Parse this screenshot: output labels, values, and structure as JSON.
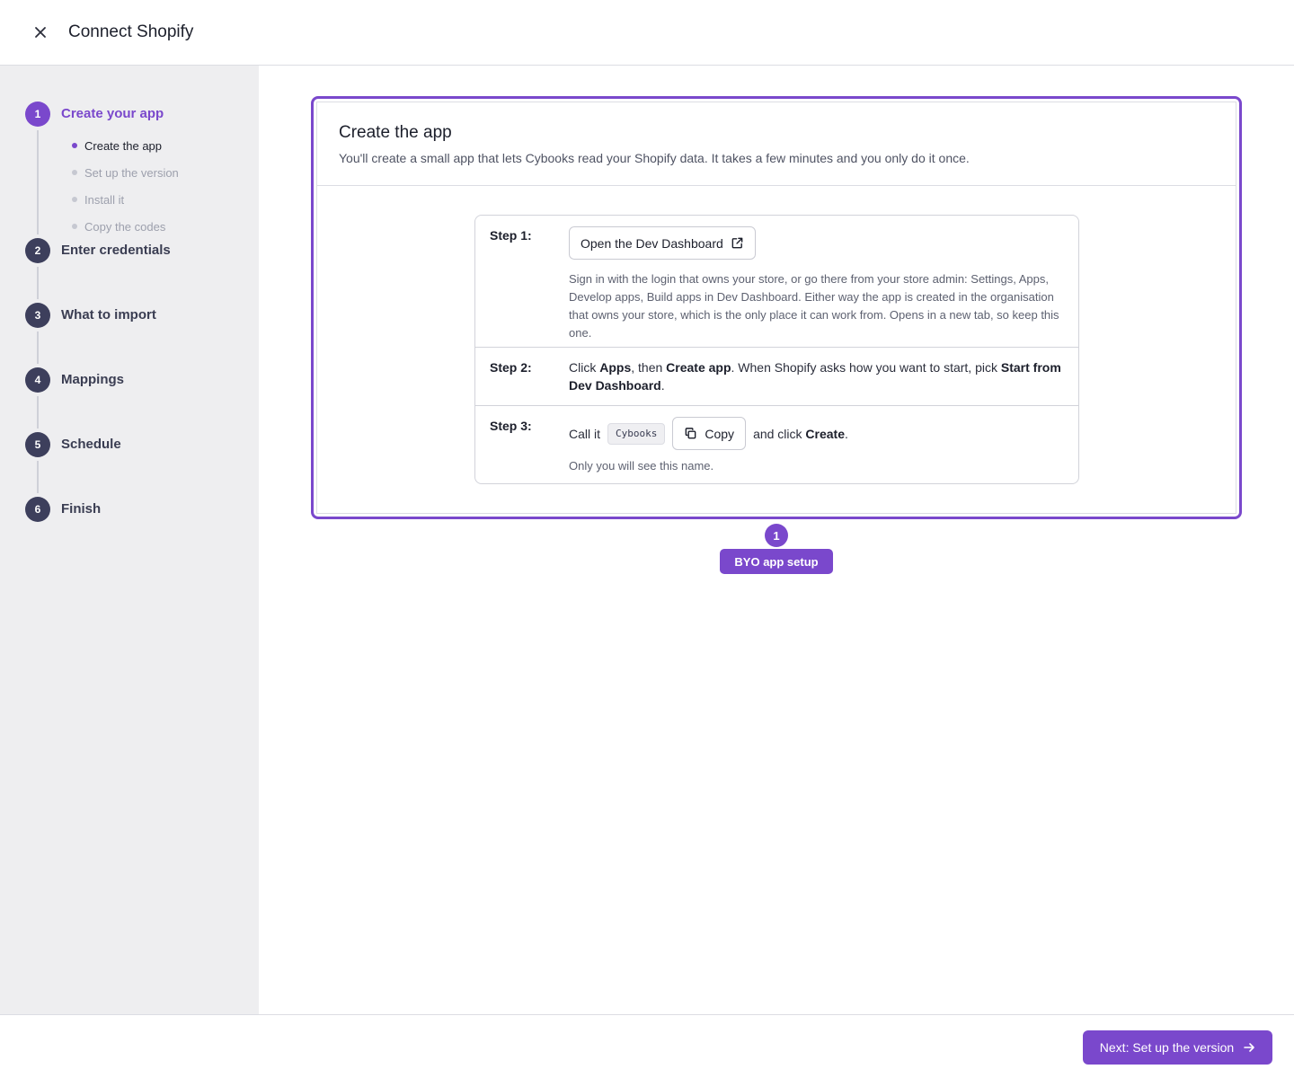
{
  "header": {
    "title": "Connect Shopify",
    "close_icon": "close-icon"
  },
  "sidebar": {
    "steps": [
      {
        "number": "1",
        "label": "Create your app",
        "active": true,
        "substeps": [
          {
            "label": "Create the app",
            "current": true
          },
          {
            "label": "Set up the version",
            "current": false
          },
          {
            "label": "Install it",
            "current": false
          },
          {
            "label": "Copy the codes",
            "current": false
          }
        ]
      },
      {
        "number": "2",
        "label": "Enter credentials"
      },
      {
        "number": "3",
        "label": "What to import"
      },
      {
        "number": "4",
        "label": "Mappings"
      },
      {
        "number": "5",
        "label": "Schedule"
      },
      {
        "number": "6",
        "label": "Finish"
      }
    ]
  },
  "card": {
    "title": "Create the app",
    "subtitle": "You'll create a small app that lets Cybooks read your Shopify data. It takes a few minutes and you only do it once.",
    "steps": [
      {
        "label": "Step 1:",
        "button": "Open the Dev Dashboard",
        "button_icon": "external-link-icon",
        "description": "Sign in with the login that owns your store, or go there from your store admin: Settings, Apps, Develop apps, Build apps in Dev Dashboard. Either way the app is created in the organisation that owns your store, which is the only place it can work from. Opens in a new tab, so keep this one."
      },
      {
        "label": "Step 2:",
        "text_1": "Click ",
        "bold_1": "Apps",
        "text_2": ", then ",
        "bold_2": "Create app",
        "text_3": ". When Shopify asks how you want to start, pick ",
        "bold_3": "Start from Dev Dashboard",
        "text_4": "."
      },
      {
        "label": "Step 3:",
        "text_1": "Call it",
        "code": "Cybooks",
        "copy_button": "Copy",
        "copy_icon": "copy-icon",
        "text_2": "and click ",
        "bold_1": "Create",
        "text_3": ".",
        "note": "Only you will see this name."
      }
    ]
  },
  "annotation": {
    "number": "1",
    "label": "BYO app setup",
    "color": "#7a48cc"
  },
  "footer": {
    "next_button": "Next: Set up the version",
    "next_icon": "arrow-right-icon"
  },
  "colors": {
    "accent": "#7a48cc",
    "step_inactive": "#3d3f5c",
    "sidebar_bg": "#eeeef0"
  }
}
